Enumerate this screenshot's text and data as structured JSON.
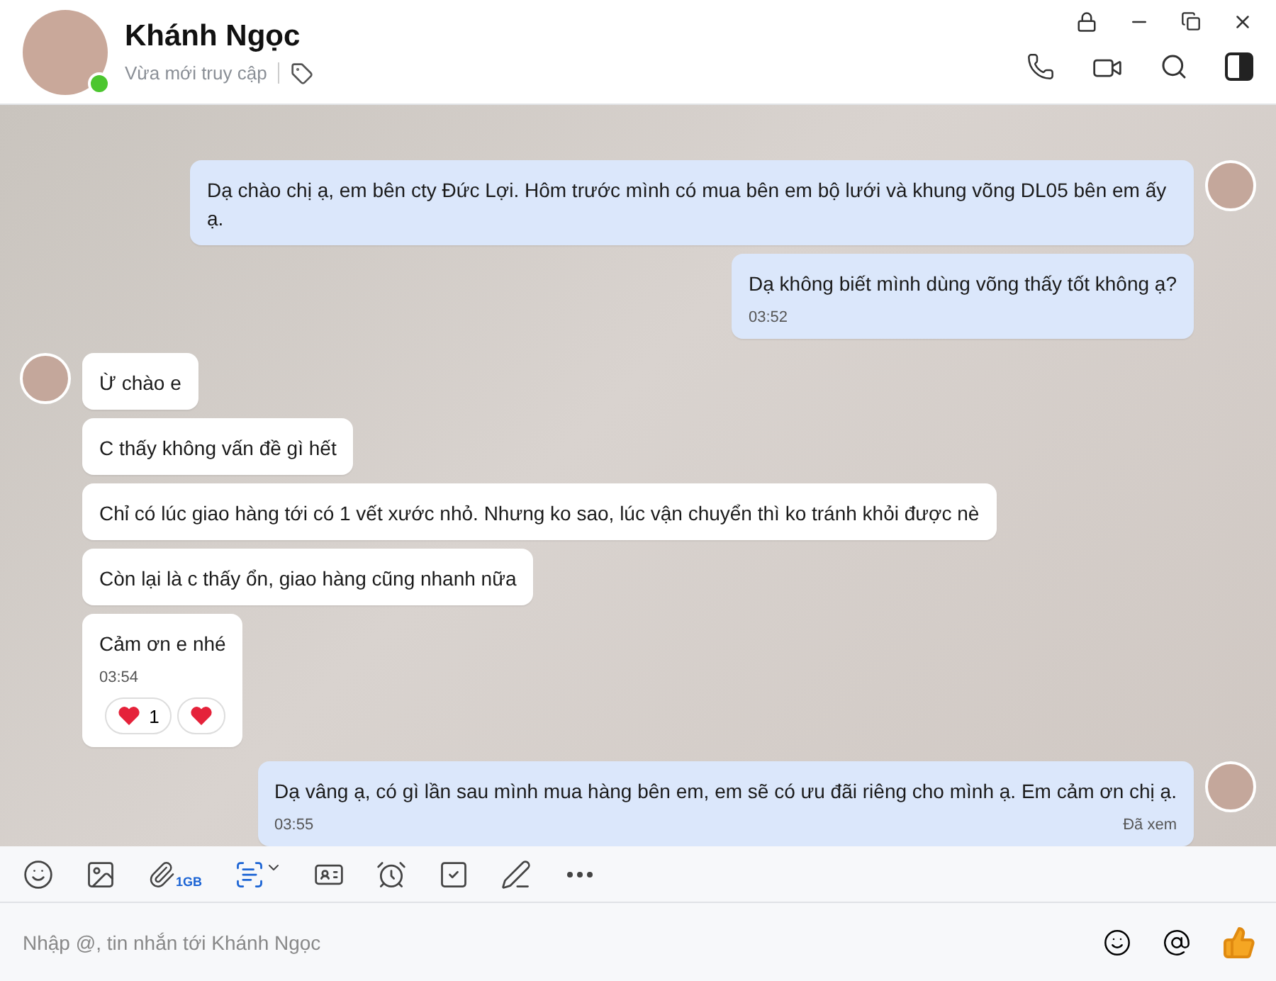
{
  "header": {
    "name": "Khánh Ngọc",
    "status": "Vừa mới truy cập",
    "online": true
  },
  "messages": [
    {
      "outgoing": true,
      "avatar": true,
      "text": "Dạ chào chị ạ, em bên cty Đức Lợi. Hôm trước mình có mua bên em bộ lưới và khung võng DL05 bên em ấy ạ."
    },
    {
      "outgoing": true,
      "avatar": false,
      "text": "Dạ không biết mình dùng võng thấy tốt không ạ?",
      "time": "03:52"
    },
    {
      "outgoing": false,
      "avatar": true,
      "text": "Ừ chào e"
    },
    {
      "outgoing": false,
      "avatar": false,
      "text": "C thấy không vấn đề gì hết"
    },
    {
      "outgoing": false,
      "avatar": false,
      "text": "Chỉ có lúc giao hàng tới có 1 vết xước nhỏ. Nhưng ko sao, lúc vận chuyển thì ko tránh khỏi được nè"
    },
    {
      "outgoing": false,
      "avatar": false,
      "text": "Còn lại là c thấy ổn, giao hàng cũng nhanh nữa"
    },
    {
      "outgoing": false,
      "avatar": false,
      "text": "Cảm ơn e nhé",
      "time": "03:54",
      "reaction_count": "1"
    },
    {
      "outgoing": true,
      "avatar": true,
      "text": "Dạ vâng ạ, có gì lần sau mình mua hàng bên em, em sẽ có ưu đãi riêng cho mình ạ. Em cảm ơn chị ạ.",
      "time": "03:55",
      "seen": "Đã xem"
    }
  ],
  "toolbar": {
    "attach_limit": "1GB"
  },
  "composer": {
    "placeholder": "Nhập @, tin nhắn tới Khánh Ngọc"
  }
}
